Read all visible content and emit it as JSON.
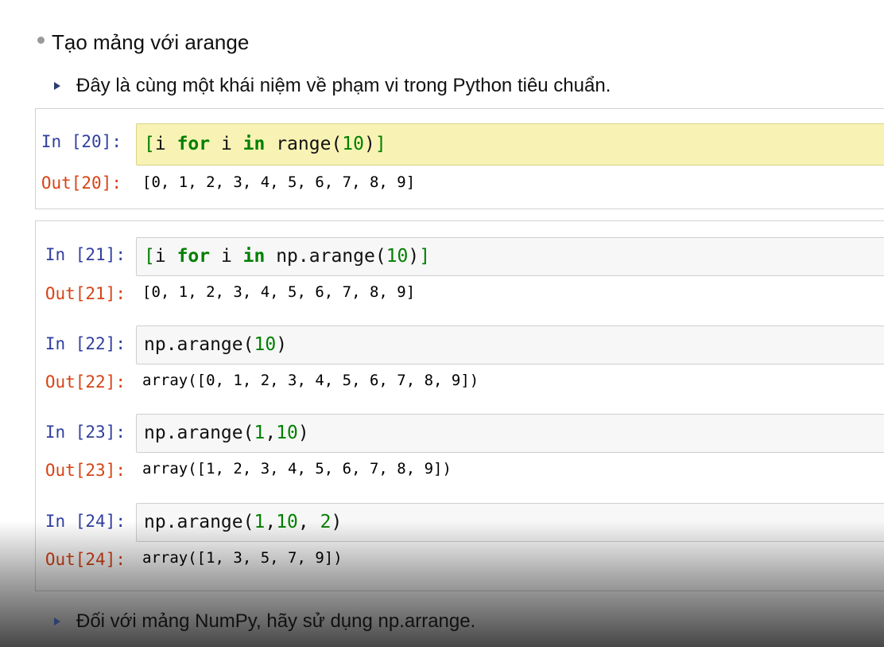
{
  "slide": {
    "bullet1": "Tạo mảng với arange",
    "bullet2": "Đây là cùng một khái niệm về phạm vi trong Python tiêu chuẩn.",
    "bullet3": "Đối với mảng NumPy, hãy sử dụng np.arrange."
  },
  "cells": [
    {
      "in_prompt": "In [20]:",
      "code": {
        "p1": "[",
        "p2": "i ",
        "p3": "for",
        "p4": " i ",
        "p5": "in",
        "p6": " range(",
        "p7": "10",
        "p8": ")",
        "p9": "]"
      },
      "out_prompt": "Out[20]:",
      "output": "[0, 1, 2, 3, 4, 5, 6, 7, 8, 9]"
    },
    {
      "in_prompt": "In [21]:",
      "code": {
        "p1": "[",
        "p2": "i ",
        "p3": "for",
        "p4": " i ",
        "p5": "in",
        "p6": " np.arange(",
        "p7": "10",
        "p8": ")",
        "p9": "]"
      },
      "out_prompt": "Out[21]:",
      "output": "[0, 1, 2, 3, 4, 5, 6, 7, 8, 9]"
    },
    {
      "in_prompt": "In [22]:",
      "code": {
        "p1": "np.arange(",
        "p2": "10",
        "p3": ")"
      },
      "out_prompt": "Out[22]:",
      "output": "array([0, 1, 2, 3, 4, 5, 6, 7, 8, 9])"
    },
    {
      "in_prompt": "In [23]:",
      "code": {
        "p1": "np.arange(",
        "p2": "1",
        "p3": ",",
        "p4": "10",
        "p5": ")"
      },
      "out_prompt": "Out[23]:",
      "output": "array([1, 2, 3, 4, 5, 6, 7, 8, 9])"
    },
    {
      "in_prompt": "In [24]:",
      "code": {
        "p1": "np.arange(",
        "p2": "1",
        "p3": ",",
        "p4": "10",
        "p5": ", ",
        "p6": "2",
        "p7": ")"
      },
      "out_prompt": "Out[24]:",
      "output": "array([1, 3, 5, 7, 9])"
    }
  ],
  "colors": {
    "in_prompt": "#303f9f",
    "out_prompt": "#d84315",
    "keyword": "#008000",
    "active_cell": "#f8f3b4"
  }
}
